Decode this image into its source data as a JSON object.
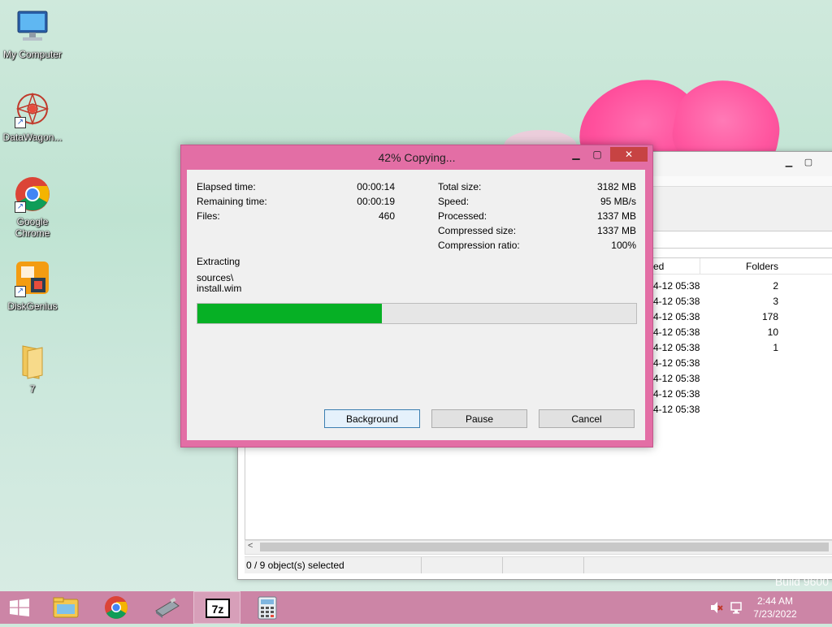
{
  "desktop": {
    "icons": [
      {
        "label": "My Computer"
      },
      {
        "label": "DataWagon..."
      },
      {
        "label": "Google Chrome"
      },
      {
        "label": "DiskGenius"
      },
      {
        "label": "7"
      }
    ],
    "watermark": "Build 9600"
  },
  "explorer": {
    "columns": {
      "modified": "ed",
      "folders": "Folders"
    },
    "rows": [
      {
        "modified": "4-12 05:38",
        "folders": "2"
      },
      {
        "modified": "4-12 05:38",
        "folders": "3"
      },
      {
        "modified": "4-12 05:38",
        "folders": "178"
      },
      {
        "modified": "4-12 05:38",
        "folders": "10"
      },
      {
        "modified": "4-12 05:38",
        "folders": "1"
      },
      {
        "modified": "4-12 05:38",
        "folders": ""
      },
      {
        "modified": "4-12 05:38",
        "folders": ""
      },
      {
        "modified": "4-12 05:38",
        "folders": ""
      },
      {
        "modified": "4-12 05:38",
        "folders": ""
      }
    ],
    "status": "0 / 9 object(s) selected"
  },
  "dialog": {
    "title": "42% Copying...",
    "progress_fraction": 0.42,
    "left_stats": [
      {
        "label": "Elapsed time:",
        "value": "00:00:14"
      },
      {
        "label": "Remaining time:",
        "value": "00:00:19"
      },
      {
        "label": "Files:",
        "value": "460"
      }
    ],
    "right_stats": [
      {
        "label": "Total size:",
        "value": "3182 MB"
      },
      {
        "label": "Speed:",
        "value": "95 MB/s"
      },
      {
        "label": "Processed:",
        "value": "1337 MB"
      },
      {
        "label": "Compressed size:",
        "value": "1337 MB"
      },
      {
        "label": "Compression ratio:",
        "value": "100%"
      }
    ],
    "operation": "Extracting",
    "path_line1": "sources\\",
    "path_line2": "install.wim",
    "buttons": {
      "background": "Background",
      "pause": "Pause",
      "cancel": "Cancel"
    }
  },
  "taskbar": {
    "apps": [
      "start",
      "file-explorer",
      "chrome",
      "usb-tool",
      "7zip",
      "calculator"
    ],
    "clock_time": "2:44 AM",
    "clock_date": "7/23/2022"
  },
  "colors": {
    "dialog_frame": "#e36ea5",
    "progress_fill": "#06b025",
    "taskbar": "#cc85a6",
    "close_button": "#c74343"
  }
}
